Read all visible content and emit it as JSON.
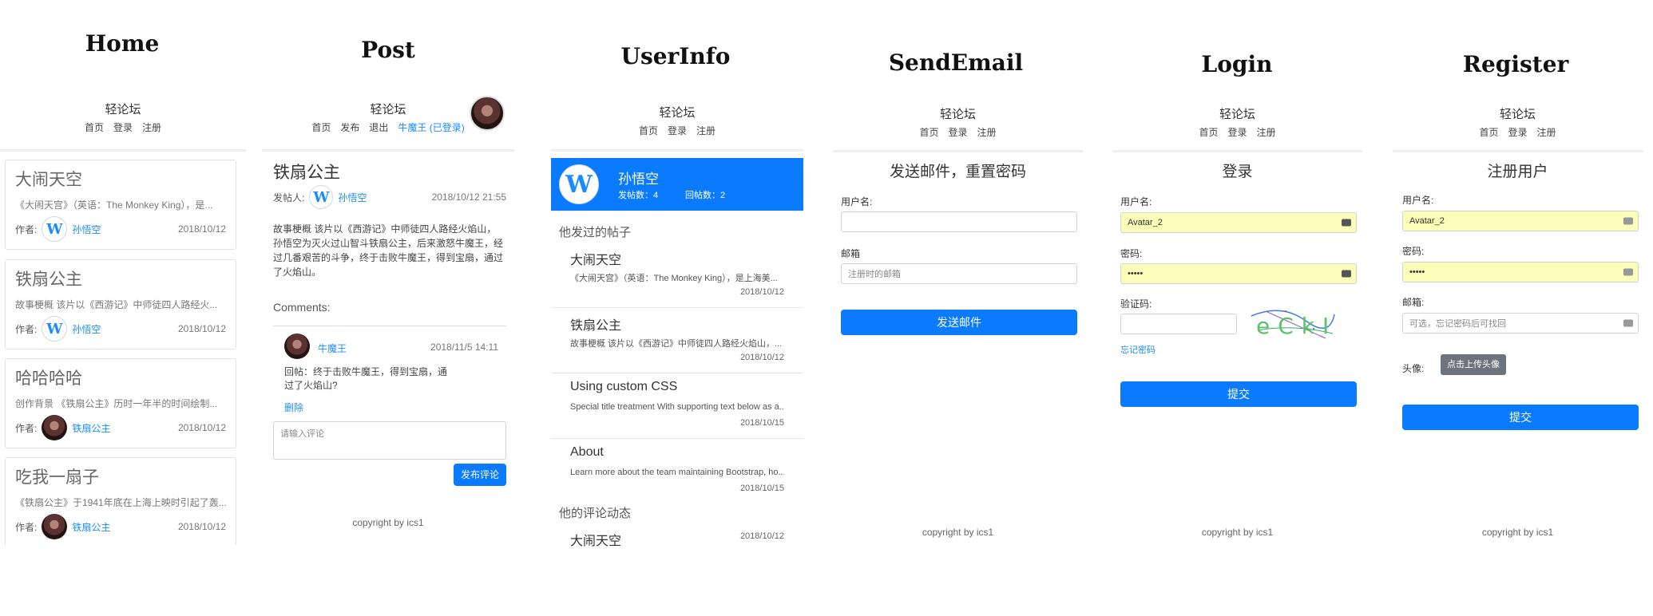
{
  "screens": {
    "home": "Home",
    "post": "Post",
    "userinfo": "UserInfo",
    "sendemail": "SendEmail",
    "login": "Login",
    "register": "Register"
  },
  "site": {
    "title": "轻论坛",
    "nav_home": "首页",
    "nav_login": "登录",
    "nav_register": "注册",
    "nav_publish": "发布",
    "nav_logout": "退出",
    "nav_user": "牛魔王 (已登录)",
    "copyright": "copyright by ics1"
  },
  "home": {
    "author_label": "作者:",
    "posts": [
      {
        "title": "大闹天空",
        "excerpt": "《大闹天宫》（英语：The Monkey King），是...",
        "author": "孙悟空",
        "avatar": "W",
        "date": "2018/10/12"
      },
      {
        "title": "铁扇公主",
        "excerpt": "故事梗概 该片以《西游记》中师徒四人路经火...",
        "author": "孙悟空",
        "avatar": "W",
        "date": "2018/10/12"
      },
      {
        "title": "哈哈哈哈",
        "excerpt": "创作背景 《铁扇公主》历时一年半的时间绘制...",
        "author": "铁扇公主",
        "avatar": "photo",
        "date": "2018/10/12"
      },
      {
        "title": "吃我一扇子",
        "excerpt": "《铁扇公主》于1941年底在上海上映时引起了轰...",
        "author": "铁扇公主",
        "avatar": "photo",
        "date": "2018/10/12"
      }
    ]
  },
  "post": {
    "title": "铁扇公主",
    "poster_label": "发帖人:",
    "poster": "孙悟空",
    "datetime": "2018/10/12 21:55",
    "body": "故事梗概 该片以《西游记》中师徒四人路经火焰山，孙悟空为灭火过山智斗铁扇公主，后来激怒牛魔王，经过几番艰苦的斗争，终于击败牛魔王，得到宝扇，通过了火焰山。",
    "comments_label": "Comments:",
    "comment": {
      "author": "牛魔王",
      "datetime": "2018/11/5 14:11",
      "text": "回帖：终于击败牛魔王，得到宝扇，通过了火焰山?",
      "delete": "删除"
    },
    "comment_placeholder": "请输入评论",
    "submit_label": "发布评论"
  },
  "userinfo": {
    "name": "孙悟空",
    "posts_count_label": "发帖数：4",
    "replies_count_label": "回帖数：2",
    "avatar": "W",
    "posts_heading": "他发过的帖子",
    "posts": [
      {
        "title": "大闹天空",
        "excerpt": "《大闹天宫》（英语：The Monkey King），是上海美...",
        "date": "2018/10/12"
      },
      {
        "title": "铁扇公主",
        "excerpt": "故事梗概 该片以《西游记》中师徒四人路经火焰山，...",
        "date": "2018/10/12"
      },
      {
        "title": "Using custom CSS",
        "excerpt": "Special title treatment With supporting text below as a...",
        "date": "2018/10/15"
      },
      {
        "title": "About",
        "excerpt": "Learn more about the team maintaining Bootstrap, ho...",
        "date": "2018/10/15"
      }
    ],
    "comments_heading": "他的评论动态",
    "comment": {
      "title": "大闹天空",
      "date": "2018/10/12"
    }
  },
  "sendemail": {
    "heading": "发送邮件，重置密码",
    "username_label": "用户名:",
    "email_label": "邮箱",
    "email_placeholder": "注册时的邮箱",
    "submit_label": "发送邮件"
  },
  "login": {
    "heading": "登录",
    "username_label": "用户名:",
    "username_value": "Avatar_2",
    "password_label": "密码:",
    "password_value": "•••••",
    "captcha_label": "验证码:",
    "captcha_text": "eCkI",
    "forgot_label": "忘记密码",
    "submit_label": "提交"
  },
  "register": {
    "heading": "注册用户",
    "username_label": "用户名:",
    "username_value": "Avatar_2",
    "password_label": "密码:",
    "password_value": "•••••",
    "email_label": "邮箱:",
    "email_placeholder": "可选，忘记密码后可找回",
    "avatar_label": "头像:",
    "upload_label": "点击上传头像",
    "submit_label": "提交"
  },
  "colors": {
    "primary": "#0a7bff",
    "link": "#1a8cff",
    "autofill": "#fbfdb8"
  }
}
